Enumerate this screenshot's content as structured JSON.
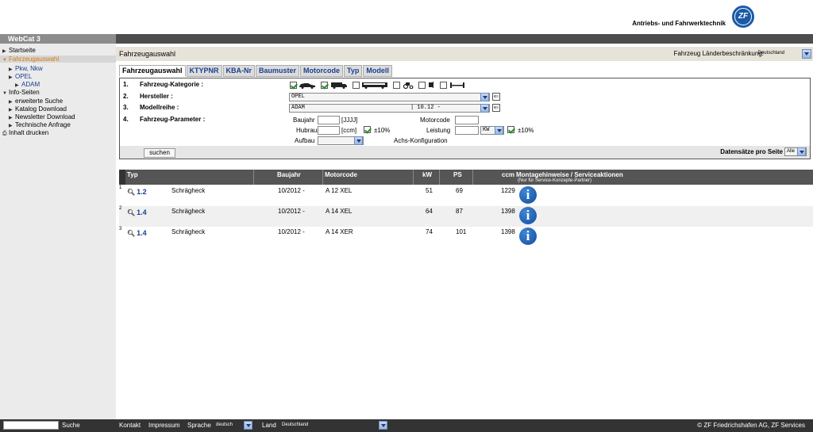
{
  "header": {
    "brand_text": "Antriebs- und Fahrwerktechnik",
    "logo_text": "ZF",
    "app_title": "WebCat 3"
  },
  "sidebar": {
    "items": [
      {
        "label": "Startseite"
      },
      {
        "label": "Fahrzeugauswahl"
      },
      {
        "label": "Pkw, Nkw"
      },
      {
        "label": "OPEL"
      },
      {
        "label": "ADAM"
      },
      {
        "label": "Info-Seiten"
      },
      {
        "label": "erweiterte Suche"
      },
      {
        "label": "Katalog Download"
      },
      {
        "label": "Newsletter Download"
      },
      {
        "label": "Technische Anfrage"
      },
      {
        "label": "Inhalt drucken"
      }
    ]
  },
  "main": {
    "section_title": "Fahrzeugauswahl",
    "region_label": "Fahrzeug Länderbeschränkung:",
    "region_value": "Deutschland",
    "tabs": [
      {
        "label": "Fahrzeugauswahl"
      },
      {
        "label": "KTYPNR"
      },
      {
        "label": "KBA-Nr"
      },
      {
        "label": "Baumuster"
      },
      {
        "label": "Motorcode"
      },
      {
        "label": "Typ"
      },
      {
        "label": "Modell"
      }
    ],
    "form": {
      "rows": [
        {
          "num": "1.",
          "label": "Fahrzeug-Kategorie :"
        },
        {
          "num": "2.",
          "label": "Hersteller :"
        },
        {
          "num": "3.",
          "label": "Modellreihe :"
        },
        {
          "num": "4.",
          "label": "Fahrzeug-Parameter :"
        }
      ],
      "hersteller_value": "OPEL",
      "modellreihe_value": "ADAM",
      "modellreihe_extra": "| 10.12 -",
      "baujahr_label": "Baujahr",
      "baujahr_unit": "[JJJJ]",
      "motorcode_label": "Motorcode",
      "hubraum_label": "Hubraum",
      "hubraum_unit": "[ccm]",
      "hubraum_tol": "±10%",
      "leistung_label": "Leistung",
      "leistung_unit": "KW",
      "leistung_tol": "±10%",
      "aufbau_label": "Aufbau",
      "achs_label": "Achs-Konfiguration",
      "search_button": "suchen",
      "records_label": "Datensätze pro Seite",
      "records_value": "Alle"
    }
  },
  "results": {
    "columns": {
      "typ": "Typ",
      "baujahr": "Baujahr",
      "motorcode": "Motorcode",
      "kw": "kW",
      "ps": "PS",
      "ccm": "ccm",
      "montage": "Montagehinweise / Serviceaktionen",
      "montage_sub": "(Nur für Service-Konzepte-Partner)"
    },
    "rows": [
      {
        "num": "1",
        "typ": "1.2",
        "body": "Schrägheck",
        "baujahr": "10/2012 -",
        "motorcode": "A 12 XEL",
        "kw": "51",
        "ps": "69",
        "ccm": "1229"
      },
      {
        "num": "2",
        "typ": "1.4",
        "body": "Schrägheck",
        "baujahr": "10/2012 -",
        "motorcode": "A 14 XEL",
        "kw": "64",
        "ps": "87",
        "ccm": "1398"
      },
      {
        "num": "3",
        "typ": "1.4",
        "body": "Schrägheck",
        "baujahr": "10/2012 -",
        "motorcode": "A 14 XER",
        "kw": "74",
        "ps": "101",
        "ccm": "1398"
      }
    ]
  },
  "footer": {
    "search_label": "Suche",
    "kontakt": "Kontakt",
    "impressum": "Impressum",
    "sprache_label": "Sprache",
    "sprache_value": "deutsch",
    "land_label": "Land",
    "land_value": "Deutschland",
    "copyright": "© ZF Friedrichshafen AG, ZF Services"
  },
  "colors": {
    "link_blue": "#1b3f8f",
    "zf_blue": "#1b5aa6",
    "header_gray": "#4d4d4d",
    "footer_dark": "#333333",
    "section_beige": "#e8e3d9",
    "active_orange": "#d97a12"
  }
}
